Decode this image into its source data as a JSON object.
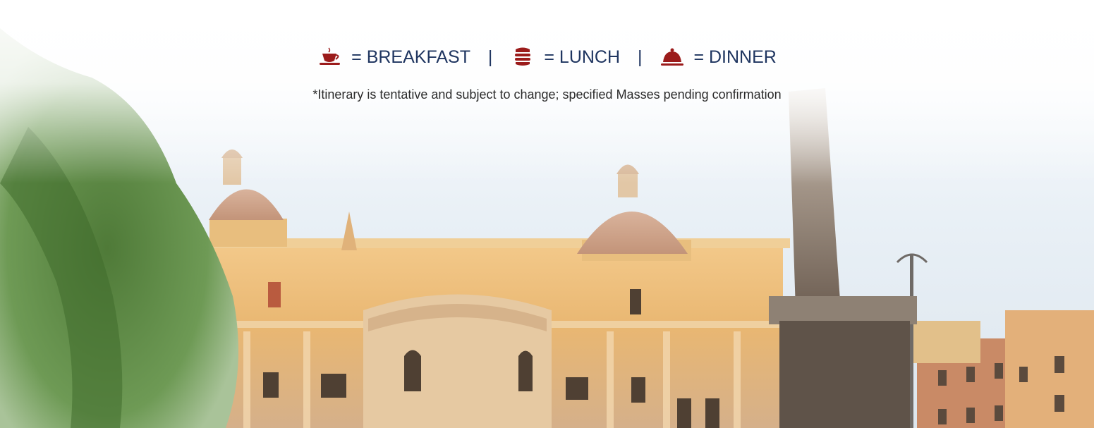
{
  "legend": {
    "items": [
      {
        "icon": "coffee-cup-icon",
        "label": "= BREAKFAST"
      },
      {
        "icon": "sandwich-icon",
        "label": "= LUNCH"
      },
      {
        "icon": "serving-cloche-icon",
        "label": "= DINNER"
      }
    ],
    "separator": "|"
  },
  "disclaimer": "*Itinerary is tentative and subject to change;  specified Masses pending confirmation",
  "colors": {
    "legend_text": "#1f3560",
    "icon": "#9b1b1b",
    "disclaimer_text": "#2a2a2a"
  },
  "background": {
    "image": "basilica-facade-photo",
    "overlay": "white-fade"
  }
}
